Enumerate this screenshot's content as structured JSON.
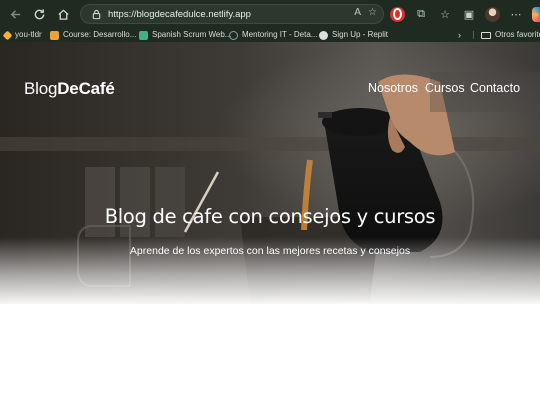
{
  "browser": {
    "url": "https://blogdecafedulce.netlify.app",
    "read_aloud_label": "A",
    "bookmarks": [
      {
        "label": "you-tldr",
        "color": "#f2b134"
      },
      {
        "label": "Course: Desarrollo...",
        "color": "#e8a33a"
      },
      {
        "label": "Spanish Scrum Web...",
        "color": "#3fb27f"
      },
      {
        "label": "Mentoring IT - Deta...",
        "color": "#8a9aa8"
      },
      {
        "label": "Sign Up - Replit",
        "color": "#dddddd"
      }
    ],
    "other_favorites": "Otros favoritos"
  },
  "site": {
    "logo_light": "Blog",
    "logo_bold": "DeCafé",
    "nav": [
      "Nosotros",
      "Cursos",
      "Contacto"
    ],
    "hero_title": "Blog de cafe con consejos y cursos",
    "hero_subtitle": "Aprende de los expertos con las mejores recetas y consejos"
  }
}
